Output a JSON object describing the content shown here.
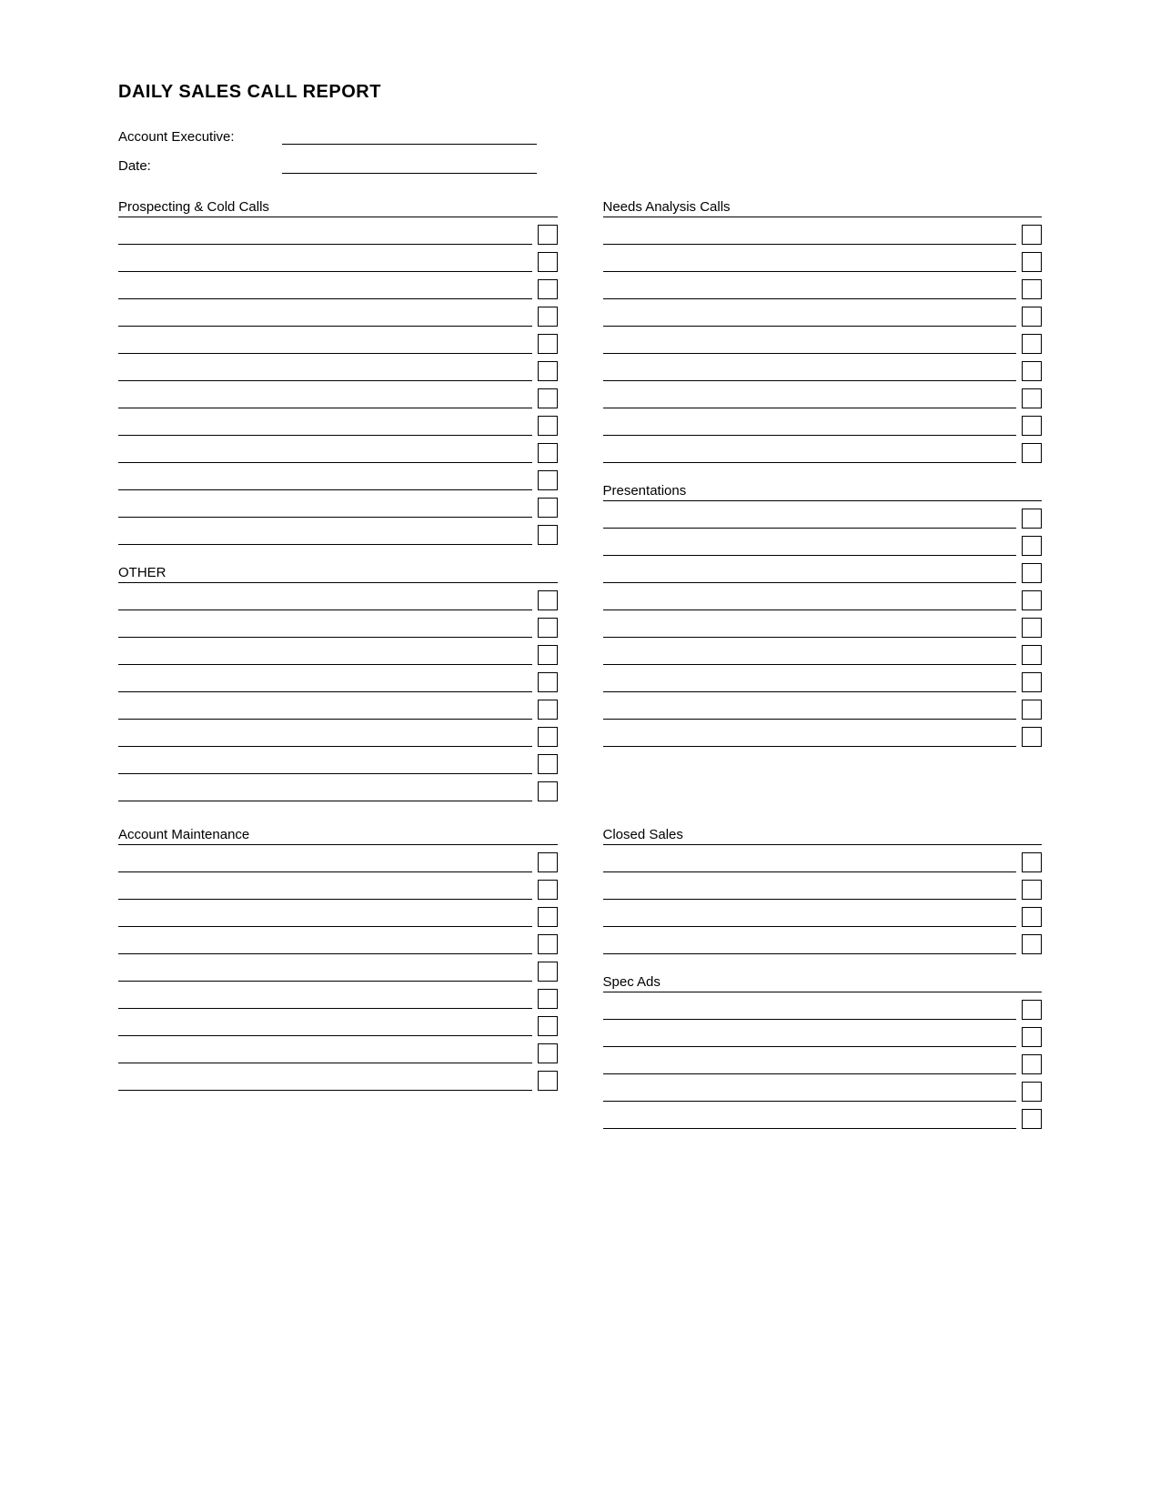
{
  "title": "DAILY SALES CALL REPORT",
  "fields": {
    "account_executive_label": "Account Executive:",
    "date_label": "Date:"
  },
  "sections": {
    "prospecting": {
      "title": "Prospecting & Cold Calls",
      "rows": 12
    },
    "other": {
      "title": "OTHER",
      "rows": 8
    },
    "needs_analysis": {
      "title": "Needs Analysis Calls",
      "rows": 9
    },
    "presentations": {
      "title": "Presentations",
      "rows": 9
    },
    "account_maintenance": {
      "title": "Account Maintenance",
      "rows": 9
    },
    "closed_sales": {
      "title": "Closed Sales",
      "rows": 4
    },
    "spec_ads": {
      "title": "Spec Ads",
      "rows": 5
    }
  }
}
